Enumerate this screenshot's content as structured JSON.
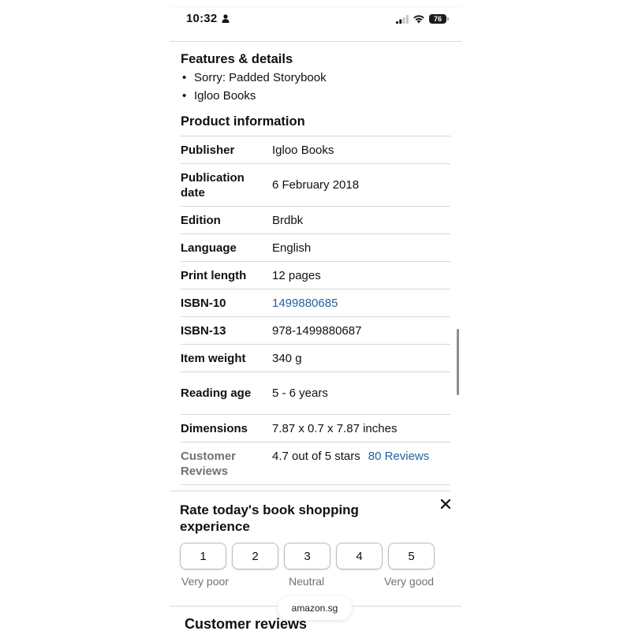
{
  "status_bar": {
    "time": "10:32",
    "battery": "76"
  },
  "features": {
    "title": "Features & details",
    "items": [
      "Sorry: Padded Storybook",
      "Igloo Books"
    ]
  },
  "product_information": {
    "title": "Product information",
    "rows": [
      {
        "label": "Publisher",
        "value": "Igloo Books"
      },
      {
        "label": "Publication date",
        "value": "6 February 2018"
      },
      {
        "label": "Edition",
        "value": "Brdbk"
      },
      {
        "label": "Language",
        "value": "English"
      },
      {
        "label": "Print length",
        "value": "12 pages"
      },
      {
        "label": "ISBN-10",
        "value": "1499880685"
      },
      {
        "label": "ISBN-13",
        "value": "978-1499880687"
      },
      {
        "label": "Item weight",
        "value": "340 g"
      },
      {
        "label": "Reading age",
        "value": "5 - 6 years"
      },
      {
        "label": "Dimensions",
        "value": "7.87 x 0.7 x 7.87 inches"
      }
    ],
    "customer_reviews": {
      "label": "Customer Reviews",
      "rating_text": "4.7 out of 5 stars",
      "reviews_link": "80 Reviews"
    }
  },
  "feedback": {
    "title": "Rate today's book shopping experience",
    "options": [
      "1",
      "2",
      "3",
      "4",
      "5"
    ],
    "scale_low": "Very poor",
    "scale_mid": "Neutral",
    "scale_high": "Very good"
  },
  "browser": {
    "url": "amazon.sg"
  },
  "customer_reviews_section": {
    "title": "Customer reviews"
  },
  "colors": {
    "link": "#2162a1",
    "text": "#0f1111",
    "muted": "#6f7373",
    "divider": "#d5d9d9"
  }
}
